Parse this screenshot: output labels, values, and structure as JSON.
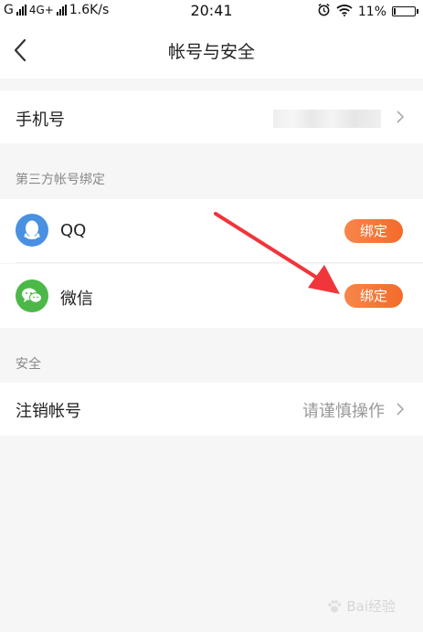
{
  "status_bar": {
    "carrier": "G",
    "network": "4G+",
    "speed": "1.6K/s",
    "time": "20:41",
    "battery": "11%",
    "battery_level": 0.11
  },
  "nav": {
    "title": "帐号与安全"
  },
  "phone_row": {
    "label": "手机号"
  },
  "third_party": {
    "section_title": "第三方帐号绑定",
    "items": [
      {
        "label": "QQ",
        "button": "绑定",
        "icon": "qq-icon",
        "color": "#4a90e2"
      },
      {
        "label": "微信",
        "button": "绑定",
        "icon": "wechat-icon",
        "color": "#4cb848"
      }
    ]
  },
  "security": {
    "section_title": "安全",
    "cancel_label": "注销帐号",
    "cancel_hint": "请谨慎操作"
  },
  "annotation": {
    "arrow_color": "#f0353b"
  },
  "watermark": {
    "text": "Bai经验"
  },
  "colors": {
    "accent": "#f36b2a",
    "background": "#f6f6f6"
  }
}
